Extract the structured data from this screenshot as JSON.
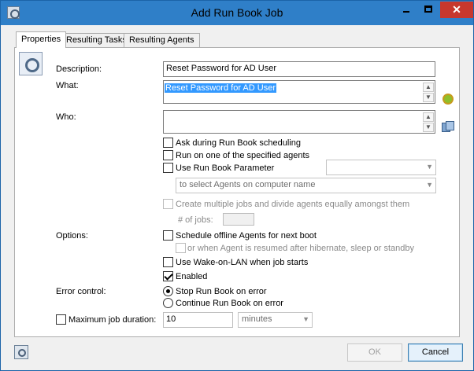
{
  "window": {
    "title": "Add Run Book Job",
    "close_glyph": "✕"
  },
  "tabs": [
    {
      "label": "Properties"
    },
    {
      "label": "Resulting Tasks"
    },
    {
      "label": "Resulting Agents"
    }
  ],
  "form": {
    "description_label": "Description:",
    "description_value": "Reset Password for AD User",
    "what_label": "What:",
    "what_value": "Reset Password for AD User",
    "who_label": "Who:",
    "who_value": "",
    "ask_scheduling": "Ask during Run Book scheduling",
    "run_specified": "Run on one of the specified agents",
    "use_parameter": "Use Run Book Parameter",
    "parameter_combo": "",
    "select_agents_combo": "to select Agents on computer name",
    "create_multiple": "Create multiple jobs and divide agents equally amongst them",
    "jobs_label": "# of jobs:",
    "options_label": "Options:",
    "schedule_offline": "Schedule offline Agents for next boot",
    "resumed": "or when Agent is resumed after hibernate, sleep or standby",
    "wake_on_lan": "Use Wake-on-LAN when job starts",
    "enabled": "Enabled",
    "error_label": "Error control:",
    "stop_on_error": "Stop Run Book on error",
    "continue_on_error": "Continue Run Book on error",
    "max_duration": "Maximum job duration:",
    "duration_value": "10",
    "duration_unit": "minutes"
  },
  "buttons": {
    "ok": "OK",
    "cancel": "Cancel"
  },
  "colors": {
    "titlebar": "#2f7fc8",
    "close": "#c7382d",
    "selection": "#3399ff"
  }
}
